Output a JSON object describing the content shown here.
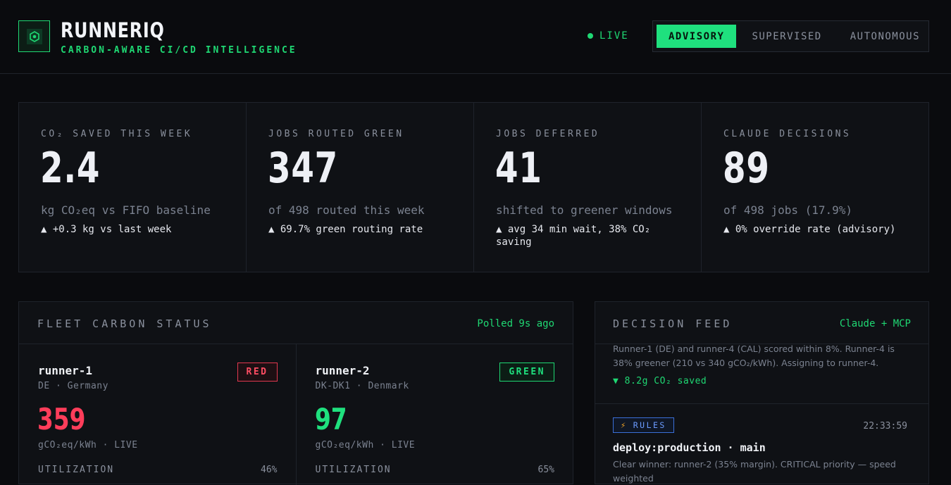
{
  "header": {
    "brand": "RUNNERIQ",
    "tagline": "CARBON-AWARE CI/CD INTELLIGENCE",
    "live_label": "LIVE",
    "modes": [
      {
        "label": "ADVISORY",
        "active": true
      },
      {
        "label": "SUPERVISED",
        "active": false
      },
      {
        "label": "AUTONOMOUS",
        "active": false
      }
    ]
  },
  "stats": [
    {
      "label": "CO₂ SAVED THIS WEEK",
      "value": "2.4",
      "sub": "kg CO₂eq vs FIFO baseline",
      "delta": "▲ +0.3 kg vs last week"
    },
    {
      "label": "JOBS ROUTED GREEN",
      "value": "347",
      "sub": "of 498 routed this week",
      "delta": "▲ 69.7% green routing rate"
    },
    {
      "label": "JOBS DEFERRED",
      "value": "41",
      "sub": "shifted to greener windows",
      "delta": "▲ avg 34 min wait, 38% CO₂ saving"
    },
    {
      "label": "CLAUDE DECISIONS",
      "value": "89",
      "sub": "of 498 jobs (17.9%)",
      "delta": "▲ 0% override rate (advisory)"
    }
  ],
  "fleet": {
    "title": "FLEET CARBON STATUS",
    "polled": "Polled 9s ago",
    "runners": [
      {
        "name": "runner-1",
        "region": "DE · Germany",
        "status": "RED",
        "intensity": "359",
        "unit": "gCO₂eq/kWh · LIVE",
        "util_label": "UTILIZATION",
        "util_value": "46%"
      },
      {
        "name": "runner-2",
        "region": "DK-DK1 · Denmark",
        "status": "GREEN",
        "intensity": "97",
        "unit": "gCO₂eq/kWh · LIVE",
        "util_label": "UTILIZATION",
        "util_value": "65%"
      }
    ]
  },
  "feed": {
    "title": "DECISION FEED",
    "source": "Claude + MCP",
    "items": [
      {
        "text": "Runner-1 (DE) and runner-4 (CAL) scored within 8%. Runner-4 is 38% greener (210 vs 340 gCO₂/kWh). Assigning to runner-4.",
        "saved": "▼ 8.2g CO₂ saved"
      },
      {
        "badge": "RULES",
        "time": "22:33:59",
        "job": "deploy:production · main",
        "text": "Clear winner: runner-2 (35% margin). CRITICAL priority — speed weighted"
      }
    ]
  },
  "colors": {
    "accent_green": "#1fe07e",
    "alert_red": "#ff3d5a",
    "rules_blue": "#6b9bff",
    "background": "#0a0b0e",
    "panel": "#0f1115"
  }
}
